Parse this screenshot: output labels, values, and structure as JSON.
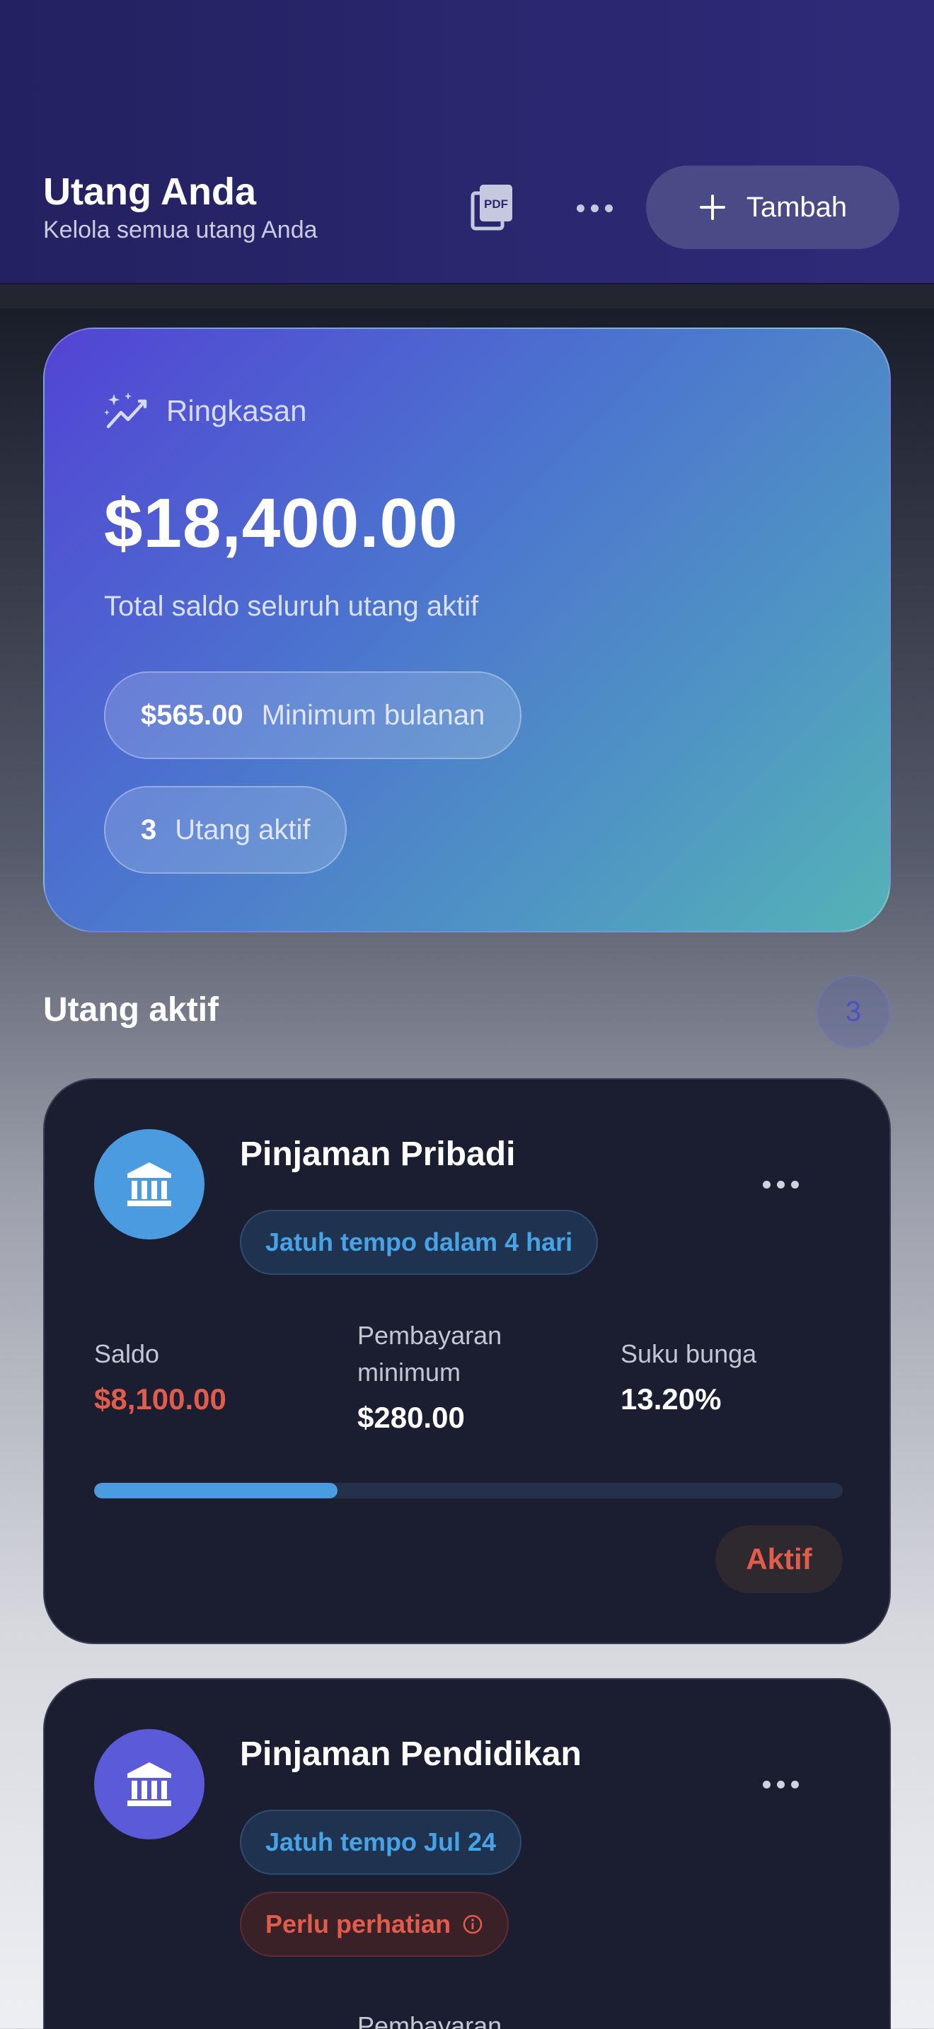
{
  "header": {
    "title": "Utang Anda",
    "subtitle": "Kelola semua utang Anda",
    "pdf_icon": "pdf-icon",
    "more_icon": "more-icon",
    "add_label": "Tambah"
  },
  "summary": {
    "label": "Ringkasan",
    "icon": "sparkle-chart-icon",
    "total": "$18,400.00",
    "description": "Total saldo seluruh utang aktif",
    "monthly_value": "$565.00",
    "monthly_label": "Minimum bulanan",
    "active_value": "3",
    "active_label": "Utang aktif"
  },
  "section": {
    "title": "Utang aktif",
    "count": "3"
  },
  "debts": [
    {
      "name": "Pinjaman Pribadi",
      "due": "Jatuh tempo dalam 4 hari",
      "balance_label": "Saldo",
      "balance": "$8,100.00",
      "min_label": "Pembayaran minimum",
      "min_payment": "$280.00",
      "rate_label": "Suku bunga",
      "rate": "13.20%",
      "progress": 0.325,
      "status": "Aktif",
      "color": "#4a9be0"
    },
    {
      "name": "Pinjaman Pendidikan",
      "due": "Jatuh tempo Jul 24",
      "warning": "Perlu perhatian",
      "min_label": "Pembayaran",
      "color": "#5b5ad8"
    }
  ],
  "colors": {
    "accent_red": "#e15c4a",
    "accent_blue": "#47a3e6",
    "card_bg": "#1b1e30"
  }
}
